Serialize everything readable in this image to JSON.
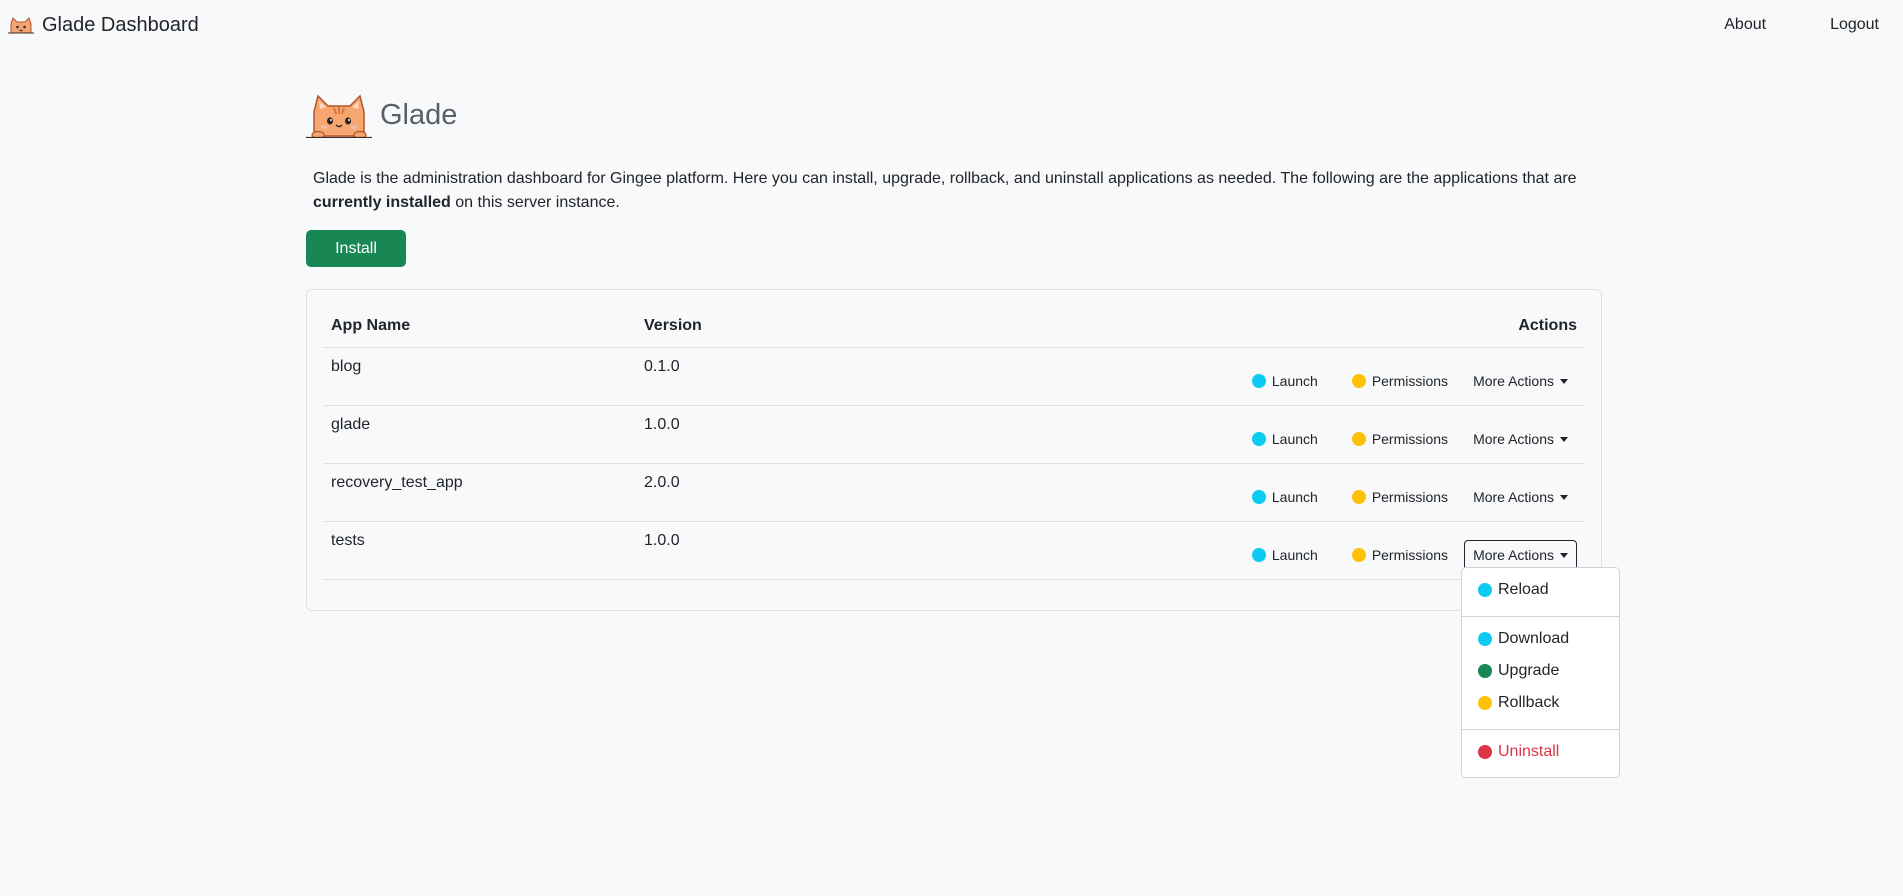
{
  "navbar": {
    "brand": "Glade Dashboard",
    "brand_icon": "cat-icon",
    "links": {
      "about": "About",
      "logout": "Logout"
    }
  },
  "header": {
    "title": "Glade",
    "logo": "cat-peeking-logo"
  },
  "intro": {
    "text_before": "Glade is the administration dashboard for Gingee platform. Here you can install, upgrade, rollback, and uninstall applications as needed. The following are the applications that are",
    "bold": "currently installed",
    "text_after": "on this server instance."
  },
  "install_label": "Install",
  "table": {
    "headers": {
      "name": "App Name",
      "version": "Version",
      "actions": "Actions"
    },
    "rows": [
      {
        "name": "blog",
        "version": "0.1.0"
      },
      {
        "name": "glade",
        "version": "1.0.0"
      },
      {
        "name": "recovery_test_app",
        "version": "2.0.0"
      },
      {
        "name": "tests",
        "version": "1.0.0"
      }
    ],
    "action_labels": {
      "launch": "Launch",
      "permissions": "Permissions",
      "more": "More Actions"
    }
  },
  "dropdown": {
    "items": {
      "reload": "Reload",
      "download": "Download",
      "upgrade": "Upgrade",
      "rollback": "Rollback",
      "uninstall": "Uninstall"
    }
  },
  "colors": {
    "primary_success": "#198754",
    "info": "#0dcaf0",
    "warning": "#ffc107",
    "danger": "#dc3545",
    "background": "#f8f9fa"
  }
}
